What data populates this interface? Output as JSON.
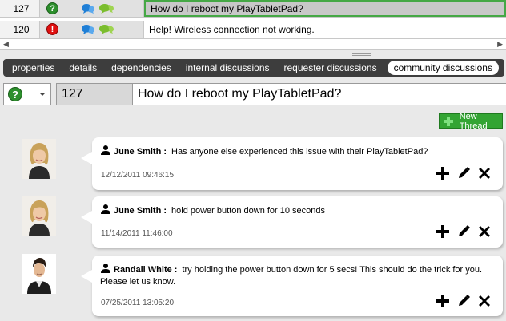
{
  "grid": {
    "rows": [
      {
        "id": "127",
        "status": "question",
        "subject": "How do I reboot my PlayTabletPad?",
        "selected": true
      },
      {
        "id": "120",
        "status": "error",
        "subject": "Help! Wireless connection not working.",
        "selected": false
      }
    ]
  },
  "tabs": [
    {
      "label": "properties",
      "active": false
    },
    {
      "label": "details",
      "active": false
    },
    {
      "label": "dependencies",
      "active": false
    },
    {
      "label": "internal discussions",
      "active": false
    },
    {
      "label": "requester discussions",
      "active": false
    },
    {
      "label": "community discussions",
      "active": true
    }
  ],
  "ticket": {
    "status_icon": "question-icon",
    "id": "127",
    "title": "How do I reboot my PlayTabletPad?"
  },
  "new_thread_label": "New Thread",
  "comments": [
    {
      "author": "June Smith :",
      "message": "Has anyone else experienced this issue with their PlayTabletPad?",
      "timestamp": "12/12/2011 09:46:15"
    },
    {
      "author": "June Smith :",
      "message": "hold power button down for 10 seconds",
      "timestamp": "11/14/2011 11:46:00"
    },
    {
      "author": "Randall White :",
      "message": "try holding the power button down for 5 secs! This should do the trick for you. Please let us know.",
      "timestamp": "07/25/2011 13:05:20"
    }
  ],
  "colors": {
    "accent_green": "#33a433",
    "selection_border": "#45a845",
    "tab_bar": "#3d3d3d",
    "status_question": "#2d8f2d",
    "status_error": "#e01010"
  }
}
